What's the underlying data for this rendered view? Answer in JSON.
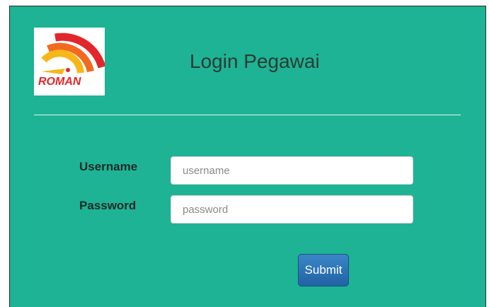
{
  "logo": {
    "text": "ROMAN",
    "colors": {
      "arc_outer": "#e3262b",
      "arc_middle": "#f26a21",
      "arc_inner": "#f7b718",
      "text": "#e3262b"
    }
  },
  "header": {
    "title": "Login Pegawai"
  },
  "form": {
    "username_label": "Username",
    "username_placeholder": "username",
    "username_value": "",
    "password_label": "Password",
    "password_placeholder": "password",
    "password_value": "",
    "submit_label": "Submit"
  },
  "colors": {
    "panel_background": "#1db394",
    "button": "#2a6fb4"
  }
}
